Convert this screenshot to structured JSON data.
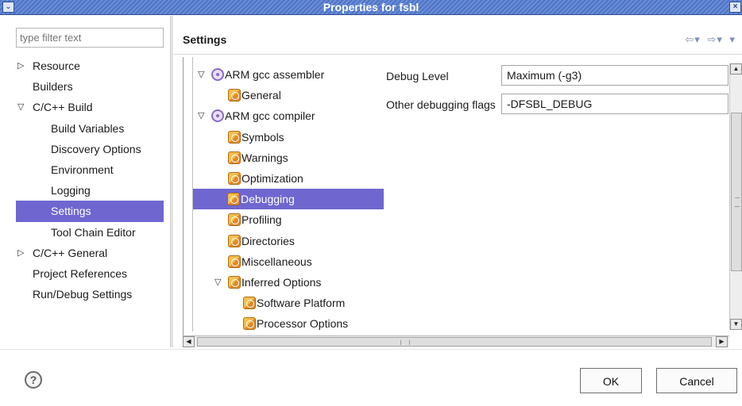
{
  "window": {
    "title": "Properties for fsbl",
    "menu_icon": "chevron-down-icon",
    "close_icon": "close-icon",
    "close_glyph": "×",
    "menu_glyph": "⌄"
  },
  "filter": {
    "placeholder": "type filter text"
  },
  "nav": {
    "items": [
      {
        "label": "Resource",
        "twisty": "▷"
      },
      {
        "label": "Builders"
      },
      {
        "label": "C/C++ Build",
        "twisty": "▽"
      },
      {
        "label": "Build Variables"
      },
      {
        "label": "Discovery Options"
      },
      {
        "label": "Environment"
      },
      {
        "label": "Logging"
      },
      {
        "label": "Settings"
      },
      {
        "label": "Tool Chain Editor"
      },
      {
        "label": "C/C++ General",
        "twisty": "▷"
      },
      {
        "label": "Project References"
      },
      {
        "label": "Run/Debug Settings"
      }
    ],
    "selected": "Settings"
  },
  "page": {
    "title": "Settings",
    "back_glyph": "⇦▾",
    "forward_glyph": "⇨▾",
    "menu_glyph": "▾"
  },
  "tool_tree": {
    "items": [
      {
        "label": "ARM gcc assembler",
        "twisty": "▽",
        "icon": "tool-icon"
      },
      {
        "label": "General",
        "icon": "option-category-icon"
      },
      {
        "label": "ARM gcc compiler",
        "twisty": "▽",
        "icon": "tool-icon"
      },
      {
        "label": "Symbols",
        "icon": "option-category-icon"
      },
      {
        "label": "Warnings",
        "icon": "option-category-icon"
      },
      {
        "label": "Optimization",
        "icon": "option-category-icon"
      },
      {
        "label": "Debugging",
        "icon": "option-category-icon"
      },
      {
        "label": "Profiling",
        "icon": "option-category-icon"
      },
      {
        "label": "Directories",
        "icon": "option-category-icon"
      },
      {
        "label": "Miscellaneous",
        "icon": "option-category-icon"
      },
      {
        "label": "Inferred Options",
        "twisty": "▽",
        "icon": "option-category-icon"
      },
      {
        "label": "Software Platform",
        "icon": "option-category-icon"
      },
      {
        "label": "Processor Options",
        "icon": "option-category-icon"
      }
    ],
    "selected": "Debugging"
  },
  "options": {
    "debug_level": {
      "label": "Debug Level",
      "value": "Maximum (-g3)"
    },
    "other_flags": {
      "label": "Other debugging flags",
      "value": "-DFSBL_DEBUG"
    }
  },
  "scroll": {
    "up": "▲",
    "down": "▼",
    "left": "◀",
    "right": "▶"
  },
  "footer": {
    "help_glyph": "?",
    "ok_label": "OK",
    "cancel_label": "Cancel"
  },
  "colors": {
    "selection": "#6f66d0",
    "titlebar": "#5a7fcf"
  }
}
